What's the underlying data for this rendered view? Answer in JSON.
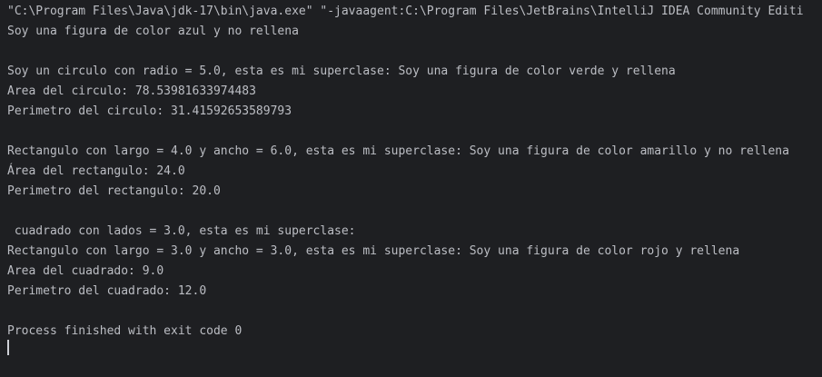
{
  "console": {
    "lines": [
      "\"C:\\Program Files\\Java\\jdk-17\\bin\\java.exe\" \"-javaagent:C:\\Program Files\\JetBrains\\IntelliJ IDEA Community Editi",
      "Soy una figura de color azul y no rellena",
      "",
      "Soy un circulo con radio = 5.0, esta es mi superclase: Soy una figura de color verde y rellena",
      "Area del circulo: 78.53981633974483",
      "Perimetro del circulo: 31.41592653589793",
      "",
      "Rectangulo con largo = 4.0 y ancho = 6.0, esta es mi superclase: Soy una figura de color amarillo y no rellena",
      "Área del rectangulo: 24.0",
      "Perimetro del rectangulo: 20.0",
      "",
      " cuadrado con lados = 3.0, esta es mi superclase:",
      "Rectangulo con largo = 3.0 y ancho = 3.0, esta es mi superclase: Soy una figura de color rojo y rellena",
      "Area del cuadrado: 9.0",
      "Perimetro del cuadrado: 12.0",
      "",
      "Process finished with exit code 0"
    ]
  }
}
